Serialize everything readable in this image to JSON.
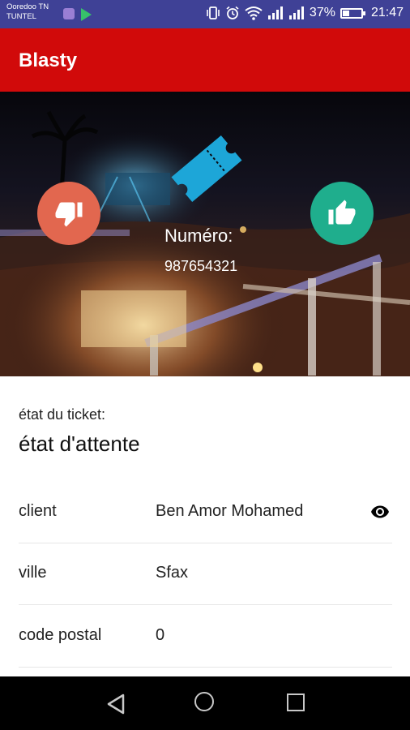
{
  "status_bar": {
    "carrier_line1": "Ooredoo TN",
    "carrier_line2": "TUNTEL",
    "battery_text": "37%",
    "battery_level": 0.37,
    "time": "21:47",
    "icons": [
      "gallery-app-icon",
      "play-store-icon",
      "vibrate-icon",
      "alarm-icon",
      "wifi-icon",
      "signal-icon",
      "signal-icon",
      "battery-icon"
    ]
  },
  "app_bar": {
    "title": "Blasty"
  },
  "hero": {
    "numero_label": "Numéro:",
    "numero_value": "987654321",
    "ticket_color": "#1da6d8",
    "dislike_color": "#e2674f",
    "like_color": "#1fae8d"
  },
  "ticket": {
    "etat_label": "état du ticket:",
    "etat_value": "état d'attente"
  },
  "details": [
    {
      "label": "client",
      "value": "Ben Amor Mohamed",
      "action_icon": "eye-icon"
    },
    {
      "label": "ville",
      "value": "Sfax"
    },
    {
      "label": "code postal",
      "value": "0"
    }
  ],
  "colors": {
    "status_bar": "#3f4196",
    "app_bar": "#d10a0a"
  }
}
